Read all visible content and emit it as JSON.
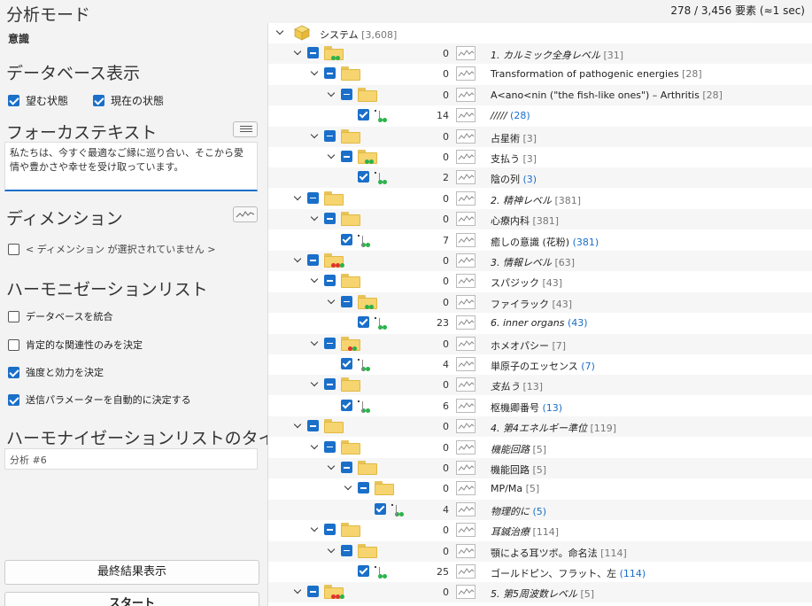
{
  "left": {
    "mode_heading": "分析モード",
    "mode_value": "意識",
    "db_display_heading": "データベース表示",
    "desired_state_label": "望む状態",
    "current_state_label": "現在の状態",
    "focus_heading": "フォーカステキスト",
    "focus_text": "私たちは、今すぐ最適なご縁に巡り合い、そこから愛情や豊かさや幸せを受け取っています。",
    "dimension_heading": "ディメンション",
    "dimension_none_label": "< ディメンション が選択されていません >",
    "harmonization_heading": "ハーモニゼーションリスト",
    "options": [
      {
        "label": "データベースを統合",
        "checked": false
      },
      {
        "label": "肯定的な関連性のみを決定",
        "checked": false
      },
      {
        "label": "強度と効力を決定",
        "checked": true
      },
      {
        "label": "送信パラメーターを自動的に決定する",
        "checked": true
      }
    ],
    "list_title_heading": "ハーモナイゼーションリストのタイトル",
    "list_title_value": "分析 #6",
    "final_button": "最終結果表示",
    "start_button": "スタート"
  },
  "status_text": "278 / 3,456 要素 (≈1 sec)",
  "tree": {
    "root_label": "システム",
    "root_count": "[3,608]",
    "rows": [
      {
        "depth": 0,
        "kind": "folder",
        "dots": "gg",
        "num": "0",
        "label": "1. カルミック全身レベル",
        "italic": true,
        "count": "[31]",
        "blue": false
      },
      {
        "depth": 1,
        "kind": "folder",
        "dots": "",
        "num": "0",
        "label": "Transformation of pathogenic energies",
        "italic": false,
        "count": "[28]",
        "blue": false
      },
      {
        "depth": 2,
        "kind": "folder",
        "dots": "",
        "num": "0",
        "label": "A<ano<nin (\"the fish-like ones\") – Arthritis",
        "italic": false,
        "count": "[28]",
        "blue": false
      },
      {
        "depth": 3,
        "kind": "leaf",
        "dots": "gg",
        "num": "14",
        "label": "/////",
        "italic": true,
        "count": "(28)",
        "blue": true
      },
      {
        "depth": 1,
        "kind": "folder",
        "dots": "",
        "num": "0",
        "label": "占星術",
        "italic": false,
        "count": "[3]",
        "blue": false
      },
      {
        "depth": 2,
        "kind": "folder",
        "dots": "gg",
        "num": "0",
        "label": "支払う",
        "italic": false,
        "count": "[3]",
        "blue": false
      },
      {
        "depth": 3,
        "kind": "leaf",
        "dots": "gg",
        "num": "2",
        "label": "陰の列",
        "italic": false,
        "count": "(3)",
        "blue": true
      },
      {
        "depth": 0,
        "kind": "folder",
        "dots": "",
        "num": "0",
        "label": "2. 精神レベル",
        "italic": true,
        "count": "[381]",
        "blue": false
      },
      {
        "depth": 1,
        "kind": "folder",
        "dots": "",
        "num": "0",
        "label": "心療内科",
        "italic": false,
        "count": "[381]",
        "blue": false
      },
      {
        "depth": 2,
        "kind": "leaf",
        "dots": "gg",
        "num": "7",
        "label": "癒しの意識 (花粉)",
        "italic": false,
        "count": "(381)",
        "blue": true
      },
      {
        "depth": 0,
        "kind": "folder",
        "dots": "rrg",
        "num": "0",
        "label": "3. 情報レベル",
        "italic": true,
        "count": "[63]",
        "blue": false
      },
      {
        "depth": 1,
        "kind": "folder",
        "dots": "",
        "num": "0",
        "label": "スパジック",
        "italic": false,
        "count": "[43]",
        "blue": false
      },
      {
        "depth": 2,
        "kind": "folder",
        "dots": "gg",
        "num": "0",
        "label": "ファイラック",
        "italic": false,
        "count": "[43]",
        "blue": false
      },
      {
        "depth": 3,
        "kind": "leaf",
        "dots": "gg",
        "num": "23",
        "label": "6. inner organs",
        "italic": true,
        "count": "(43)",
        "blue": true
      },
      {
        "depth": 1,
        "kind": "folder",
        "dots": "rg",
        "num": "0",
        "label": "ホメオパシー",
        "italic": false,
        "count": "[7]",
        "blue": false
      },
      {
        "depth": 2,
        "kind": "leaf",
        "dots": "gg",
        "num": "4",
        "label": "単原子のエッセンス",
        "italic": false,
        "count": "(7)",
        "blue": true
      },
      {
        "depth": 1,
        "kind": "folder",
        "dots": "",
        "num": "0",
        "label": "支払う",
        "italic": true,
        "count": "[13]",
        "blue": false
      },
      {
        "depth": 2,
        "kind": "leaf",
        "dots": "gg",
        "num": "6",
        "label": "枢機卿番号",
        "italic": false,
        "count": "(13)",
        "blue": true
      },
      {
        "depth": 0,
        "kind": "folder",
        "dots": "",
        "num": "0",
        "label": "4. 第4エネルギー準位",
        "italic": true,
        "count": "[119]",
        "blue": false
      },
      {
        "depth": 1,
        "kind": "folder",
        "dots": "",
        "num": "0",
        "label": "機能回路",
        "italic": true,
        "count": "[5]",
        "blue": false
      },
      {
        "depth": 2,
        "kind": "folder",
        "dots": "",
        "num": "0",
        "label": "機能回路",
        "italic": false,
        "count": "[5]",
        "blue": false
      },
      {
        "depth": 3,
        "kind": "folder",
        "dots": "",
        "num": "0",
        "label": "MP/Ma",
        "italic": false,
        "count": "[5]",
        "blue": false
      },
      {
        "depth": 4,
        "kind": "leaf",
        "dots": "gg",
        "num": "4",
        "label": "物理的に",
        "italic": true,
        "count": "(5)",
        "blue": true
      },
      {
        "depth": 1,
        "kind": "folder",
        "dots": "",
        "num": "0",
        "label": "耳鍼治療",
        "italic": true,
        "count": "[114]",
        "blue": false
      },
      {
        "depth": 2,
        "kind": "folder",
        "dots": "",
        "num": "0",
        "label": "顎による耳ツボ。命名法",
        "italic": false,
        "count": "[114]",
        "blue": false
      },
      {
        "depth": 3,
        "kind": "leaf",
        "dots": "gg",
        "num": "25",
        "label": "ゴールドピン、フラット、左",
        "italic": false,
        "count": "(114)",
        "blue": true
      },
      {
        "depth": 0,
        "kind": "folder",
        "dots": "rrg",
        "num": "0",
        "label": "5. 第5周波数レベル",
        "italic": true,
        "count": "[5]",
        "blue": false
      }
    ]
  }
}
